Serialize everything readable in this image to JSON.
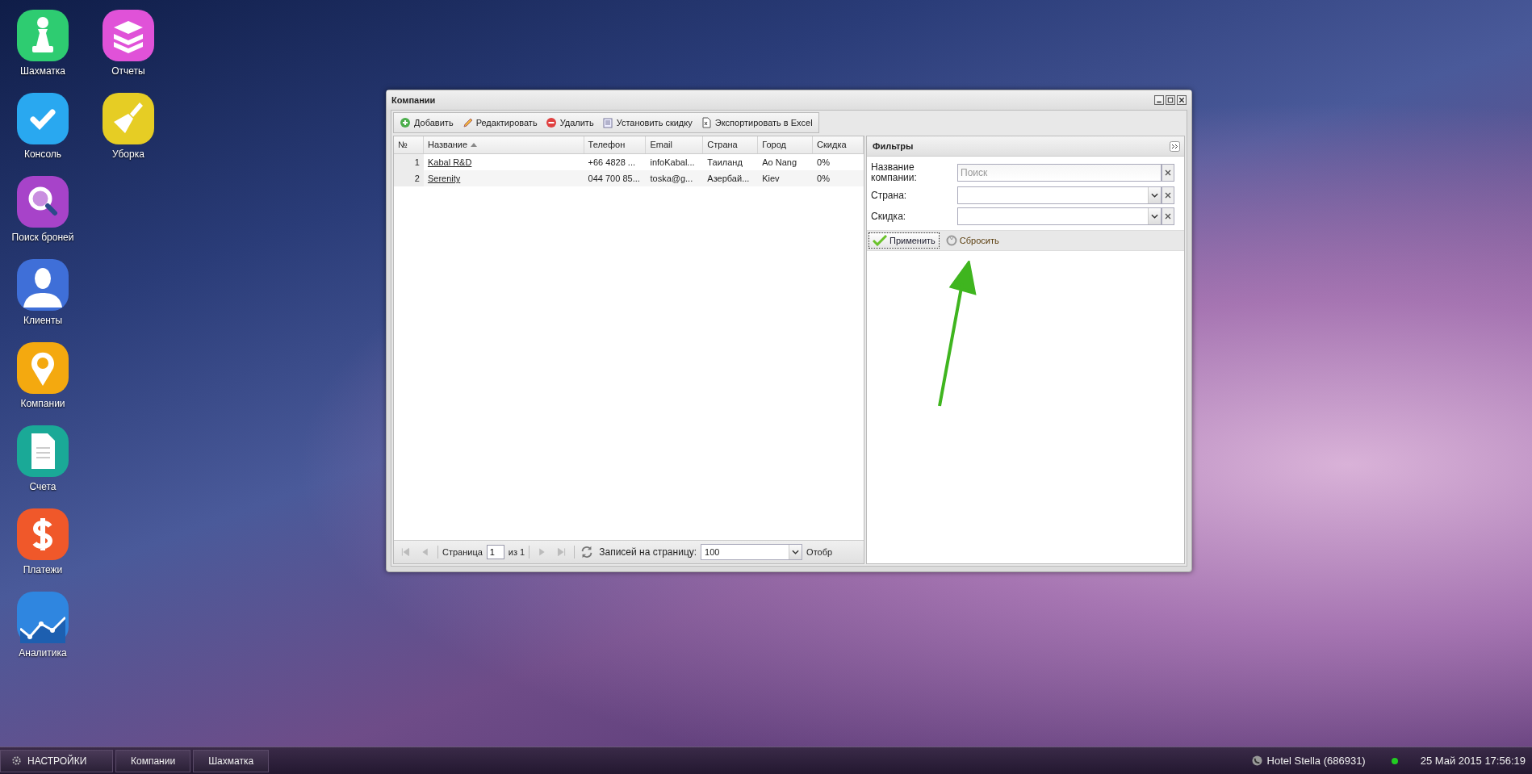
{
  "desktop_icons": [
    {
      "label": "Шахматка",
      "color": "#2ecc71"
    },
    {
      "label": "Консоль",
      "color": "#29a8f0"
    },
    {
      "label": "Поиск броней",
      "color": "#a743c9"
    },
    {
      "label": "Клиенты",
      "color": "#3f6fd8"
    },
    {
      "label": "Компании",
      "color": "#f4a90f"
    },
    {
      "label": "Счета",
      "color": "#1aa997"
    },
    {
      "label": "Платежи",
      "color": "#f0582a"
    },
    {
      "label": "Аналитика",
      "color": "#2f86e0"
    },
    {
      "label": "Отчеты",
      "color": "#e052d8"
    },
    {
      "label": "Уборка",
      "color": "#e6cd24"
    }
  ],
  "window": {
    "title": "Компании",
    "toolbar": [
      {
        "label": "Добавить"
      },
      {
        "label": "Редактировать"
      },
      {
        "label": "Удалить"
      },
      {
        "label": "Установить скидку"
      },
      {
        "label": "Экспортировать в Excel"
      }
    ],
    "table": {
      "columns": [
        {
          "label": "№",
          "sorted": false
        },
        {
          "label": "Название",
          "sorted": true
        },
        {
          "label": "Телефон",
          "sorted": false
        },
        {
          "label": "Email",
          "sorted": false
        },
        {
          "label": "Страна",
          "sorted": false
        },
        {
          "label": "Город",
          "sorted": false
        },
        {
          "label": "Скидка",
          "sorted": false
        }
      ],
      "rows": [
        {
          "number": "1",
          "name": "Kabal R&D",
          "phone": "+66 4828 ...",
          "email": "infoKabal...",
          "country": "Таиланд",
          "city": "Ao Nang",
          "discount": "0%"
        },
        {
          "number": "2",
          "name": "Serenity",
          "phone": "044 700 85...",
          "email": "toska@g...",
          "country": "Азербай...",
          "city": "Kiev",
          "discount": "0%"
        }
      ]
    },
    "pager": {
      "page_label": "Страница",
      "page_value": "1",
      "of_label": "из 1",
      "per_page_label": "Записей на страницу:",
      "per_page_value": "100",
      "display_label": "Отобр"
    },
    "filters": {
      "title": "Фильтры",
      "fields": [
        {
          "label": "Название компании:",
          "kind": "search",
          "placeholder": "Поиск"
        },
        {
          "label": "Страна:",
          "kind": "combo"
        },
        {
          "label": "Скидка:",
          "kind": "combo"
        }
      ],
      "apply": "Применить",
      "reset": "Сбросить"
    }
  },
  "taskbar": {
    "start": "НАСТРОЙКИ",
    "tasks": [
      "Компании",
      "Шахматка"
    ],
    "hotel": "Hotel Stella (686931)",
    "datetime": "25 Май 2015 17:56:19"
  }
}
